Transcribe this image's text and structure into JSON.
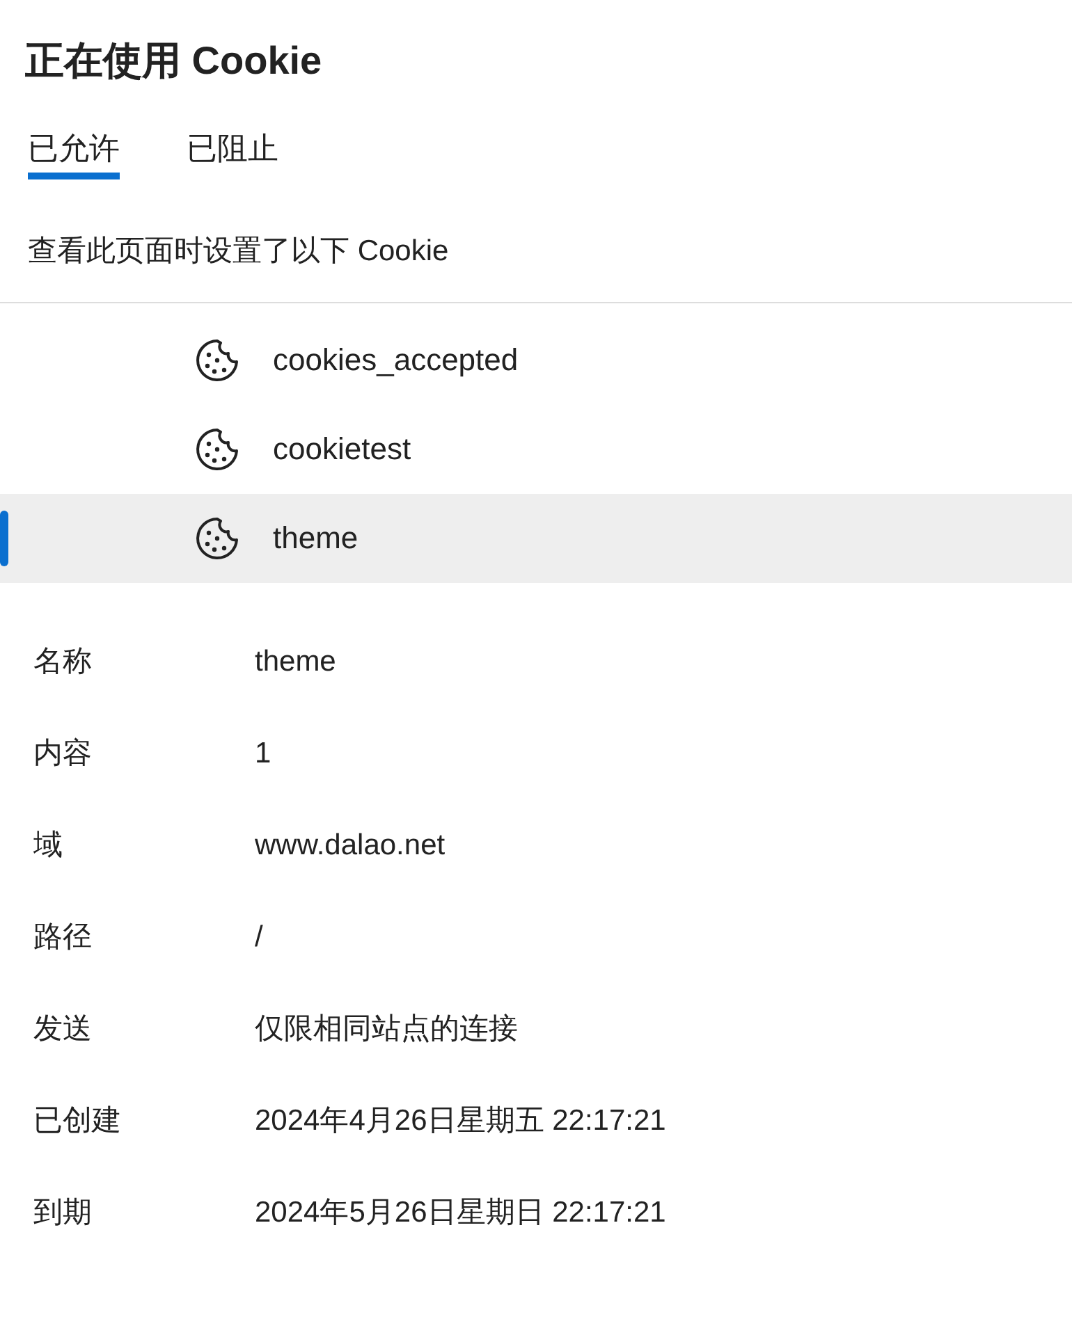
{
  "title": "正在使用 Cookie",
  "tabs": [
    {
      "label": "已允许",
      "selected": true
    },
    {
      "label": "已阻止",
      "selected": false
    }
  ],
  "description": "查看此页面时设置了以下 Cookie",
  "cookies": [
    {
      "name": "cookies_accepted",
      "selected": false
    },
    {
      "name": "cookietest",
      "selected": false
    },
    {
      "name": "theme",
      "selected": true
    }
  ],
  "details": [
    {
      "label": "名称",
      "value": "theme"
    },
    {
      "label": "内容",
      "value": "1"
    },
    {
      "label": "域",
      "value": "www.dalao.net"
    },
    {
      "label": "路径",
      "value": "/"
    },
    {
      "label": "发送",
      "value": "仅限相同站点的连接"
    },
    {
      "label": "已创建",
      "value": "2024年4月26日星期五 22:17:21"
    },
    {
      "label": "到期",
      "value": "2024年5月26日星期日 22:17:21"
    }
  ]
}
